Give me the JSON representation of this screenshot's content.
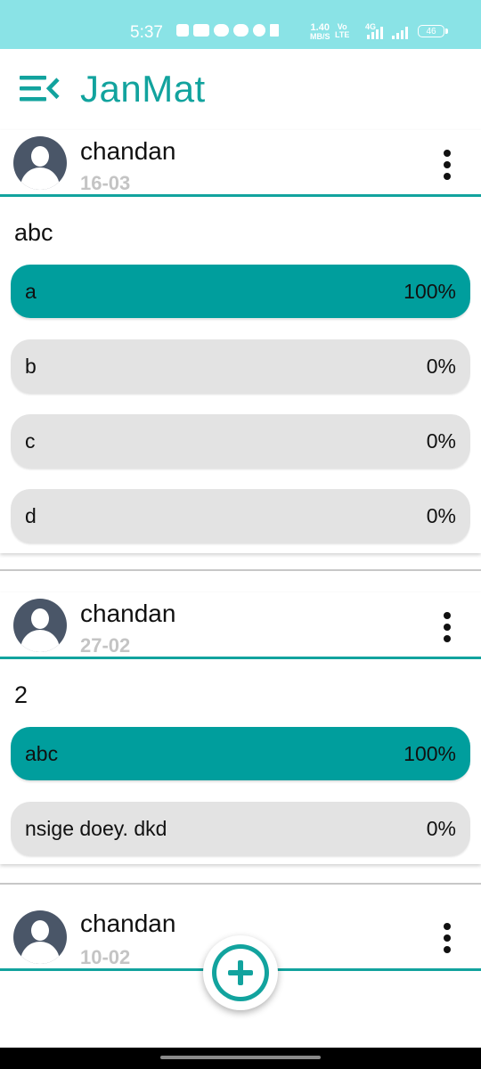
{
  "status_bar": {
    "time": "5:37",
    "network_speed_value": "1.40",
    "network_speed_unit": "MB/S",
    "volte_top": "Vo",
    "volte_bottom": "LTE",
    "network_type": "4G",
    "battery": "46",
    "bg_color": "#8ae3e6"
  },
  "app_bar": {
    "title": "JanMat",
    "menu_icon": "menu-collapse-icon",
    "accent_color": "#12a39e"
  },
  "polls": [
    {
      "user": "chandan",
      "date": "16-03",
      "question": "abc",
      "options": [
        {
          "label": "a",
          "percent": "100%",
          "selected": true
        },
        {
          "label": "b",
          "percent": "0%",
          "selected": false
        },
        {
          "label": "c",
          "percent": "0%",
          "selected": false
        },
        {
          "label": "d",
          "percent": "0%",
          "selected": false
        }
      ]
    },
    {
      "user": "chandan",
      "date": "27-02",
      "question": "2",
      "options": [
        {
          "label": "abc",
          "percent": "100%",
          "selected": true
        },
        {
          "label": "nsige doey. dkd",
          "percent": "0%",
          "selected": false
        }
      ]
    },
    {
      "user": "chandan",
      "date": "10-02"
    }
  ],
  "fab": {
    "icon": "add-circle-icon"
  },
  "colors": {
    "selected_option": "#009e9d",
    "unselected_option": "#e3e3e3"
  }
}
